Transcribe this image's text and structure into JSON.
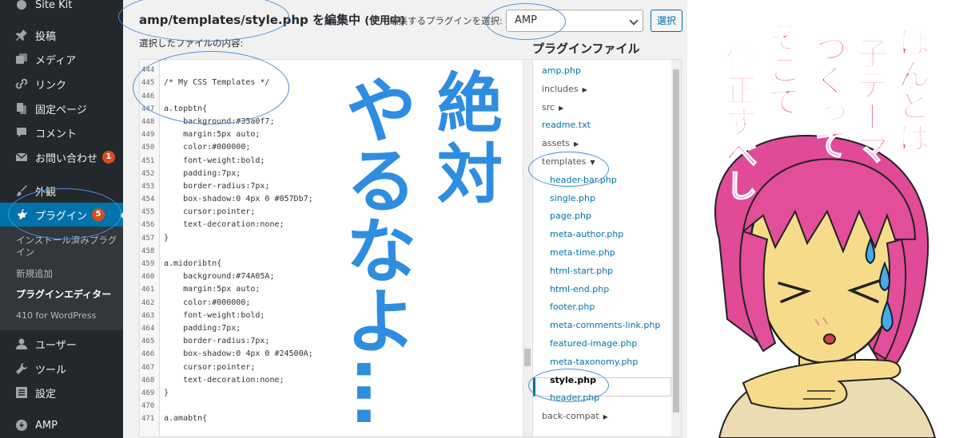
{
  "sidebar": {
    "site_kit": "Site Kit",
    "items": [
      {
        "icon": "pushpin-icon",
        "label": "投稿"
      },
      {
        "icon": "media-icon",
        "label": "メディア"
      },
      {
        "icon": "link-icon",
        "label": "リンク"
      },
      {
        "icon": "page-icon",
        "label": "固定ページ"
      },
      {
        "icon": "comment-icon",
        "label": "コメント"
      },
      {
        "icon": "mail-icon",
        "label": "お問い合わせ",
        "badge": "1"
      },
      {
        "icon": "brush-icon",
        "label": "外観"
      },
      {
        "icon": "plugin-icon",
        "label": "プラグイン",
        "badge": "5"
      },
      {
        "icon": "user-icon",
        "label": "ユーザー"
      },
      {
        "icon": "wrench-icon",
        "label": "ツール"
      },
      {
        "icon": "settings-icon",
        "label": "設定"
      },
      {
        "icon": "amp-icon",
        "label": "AMP"
      }
    ],
    "submenu": [
      "インストール済みプラグイン",
      "新規追加",
      "プラグインエディター",
      "410 for WordPress"
    ]
  },
  "editor": {
    "file_path": "amp/templates/style.php",
    "heading_suffix": " を編集中",
    "heading_status": "(使用中)",
    "select_label": "編集するプラグインを選択:",
    "selected_plugin": "AMP",
    "select_button": "選択",
    "content_label": "選択したファイルの内容:",
    "plugin_files_title": "プラグインファイル"
  },
  "code": [
    {
      "n": "443",
      "t": "}"
    },
    {
      "n": "444",
      "t": ""
    },
    {
      "n": "445",
      "t": "/* My CSS Templates */"
    },
    {
      "n": "446",
      "t": ""
    },
    {
      "n": "447",
      "t": "a.topbtn{"
    },
    {
      "n": "448",
      "t": "    background:#35a0f7;"
    },
    {
      "n": "449",
      "t": "    margin:5px auto;"
    },
    {
      "n": "450",
      "t": "    color:#000000;"
    },
    {
      "n": "451",
      "t": "    font-weight:bold;"
    },
    {
      "n": "452",
      "t": "    padding:7px;"
    },
    {
      "n": "453",
      "t": "    border-radius:7px;"
    },
    {
      "n": "454",
      "t": "    box-shadow:0 4px 0 #057Db7;"
    },
    {
      "n": "455",
      "t": "    cursor:pointer;"
    },
    {
      "n": "456",
      "t": "    text-decoration:none;"
    },
    {
      "n": "457",
      "t": "}"
    },
    {
      "n": "458",
      "t": ""
    },
    {
      "n": "459",
      "t": "a.midoribtn{"
    },
    {
      "n": "460",
      "t": "    background:#74A05A;"
    },
    {
      "n": "461",
      "t": "    margin:5px auto;"
    },
    {
      "n": "462",
      "t": "    color:#000000;"
    },
    {
      "n": "463",
      "t": "    font-weight:bold;"
    },
    {
      "n": "464",
      "t": "    padding:7px;"
    },
    {
      "n": "465",
      "t": "    border-radius:7px;"
    },
    {
      "n": "466",
      "t": "    box-shadow:0 4px 0 #24500A;"
    },
    {
      "n": "467",
      "t": "    cursor:pointer;"
    },
    {
      "n": "468",
      "t": "    text-decoration:none;"
    },
    {
      "n": "469",
      "t": "}"
    },
    {
      "n": "470",
      "t": ""
    },
    {
      "n": "471",
      "t": "a.amabtn{"
    }
  ],
  "files": [
    {
      "name": "amp.php",
      "type": "file"
    },
    {
      "name": "includes",
      "type": "dir"
    },
    {
      "name": "src",
      "type": "dir"
    },
    {
      "name": "readme.txt",
      "type": "file"
    },
    {
      "name": "assets",
      "type": "dir"
    },
    {
      "name": "templates",
      "type": "dir-open"
    },
    {
      "name": "header-bar.php",
      "type": "sub"
    },
    {
      "name": "single.php",
      "type": "sub"
    },
    {
      "name": "page.php",
      "type": "sub"
    },
    {
      "name": "meta-author.php",
      "type": "sub"
    },
    {
      "name": "meta-time.php",
      "type": "sub"
    },
    {
      "name": "html-start.php",
      "type": "sub"
    },
    {
      "name": "html-end.php",
      "type": "sub"
    },
    {
      "name": "footer.php",
      "type": "sub"
    },
    {
      "name": "meta-comments-link.php",
      "type": "sub"
    },
    {
      "name": "featured-image.php",
      "type": "sub"
    },
    {
      "name": "meta-taxonomy.php",
      "type": "sub"
    },
    {
      "name": "style.php",
      "type": "current"
    },
    {
      "name": "header.php",
      "type": "sub"
    },
    {
      "name": "back-compat",
      "type": "dir"
    }
  ],
  "overlay": {
    "warning": [
      "絶",
      "対",
      "や",
      "る",
      "な",
      "よ",
      "…"
    ],
    "manga_columns": [
      "ほんとは",
      "子テーマ",
      "つくって",
      "そこで",
      "修正すべし"
    ],
    "warning_color": "#2e8ddf",
    "manga_color": "#e8367a"
  },
  "colors": {
    "sidebar_bg": "#23282d",
    "accent": "#0073aa",
    "badge": "#d54e21",
    "highlight": "#4a8fd8"
  }
}
